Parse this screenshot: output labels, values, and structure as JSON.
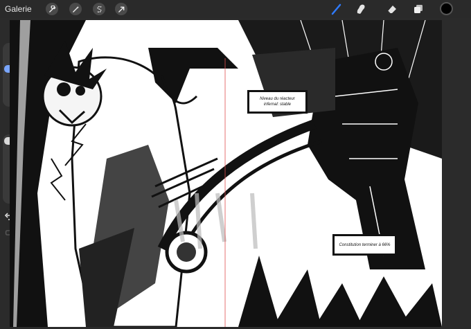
{
  "toolbar": {
    "gallery_label": "Galerie",
    "left_tools": [
      "wrench-icon",
      "magic-wand-icon",
      "selection-s-icon",
      "transform-arrow-icon"
    ],
    "right_tools": [
      "brush-icon",
      "smudge-icon",
      "eraser-icon",
      "layers-icon"
    ],
    "active_tool": "brush-icon",
    "accent_color": "#2f7bff",
    "current_color": "#000000"
  },
  "sidebar": {
    "size_slider_level": 0.35,
    "opacity_slider_level": 0.0,
    "modifier_icon": "square-modifier-icon",
    "undo_icon": "undo-icon",
    "redo_icon": "redo-icon"
  },
  "canvas": {
    "captions": [
      {
        "lines": [
          "Niveau du réacteur",
          "infernal: stable"
        ]
      },
      {
        "lines": [
          "Constitution terminer à 66%"
        ]
      }
    ]
  }
}
